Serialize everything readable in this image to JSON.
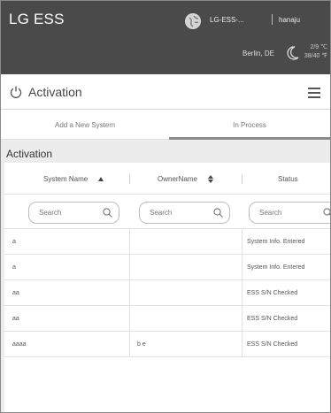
{
  "header": {
    "app_title": "LG ESS",
    "site_name": "LG-ESS-...",
    "user_name": "hanaju",
    "location": "Berlin, DE",
    "weather_temp": "2/9 ℃",
    "weather_extra": "38/40 ℉"
  },
  "page": {
    "title": "Activation"
  },
  "tabs": [
    {
      "label": "Add a New System",
      "active": false
    },
    {
      "label": "In Process",
      "active": true
    }
  ],
  "section": {
    "title": "Activation"
  },
  "table": {
    "columns": [
      {
        "label": "System Name",
        "sort": "asc"
      },
      {
        "label": "OwnerName",
        "sort": "both"
      },
      {
        "label": "Status",
        "sort": "none"
      }
    ],
    "search_placeholders": [
      "Search",
      "Search",
      "Search"
    ],
    "rows": [
      {
        "system_name": "a",
        "owner_name": "",
        "status": "System Info. Entered"
      },
      {
        "system_name": "a",
        "owner_name": "",
        "status": "System Info. Entered"
      },
      {
        "system_name": "aa",
        "owner_name": "",
        "status": "ESS S/N Checked"
      },
      {
        "system_name": "aa",
        "owner_name": "",
        "status": "ESS S/N Checked"
      },
      {
        "system_name": "aaaa",
        "owner_name": "b e",
        "status": "ESS S/N Checked"
      }
    ]
  },
  "colors": {
    "header_bg": "#4a4a4a",
    "content_bg": "#ececec",
    "active_tab_underline": "#8b8b8b"
  },
  "icons": [
    "globe-icon",
    "moon-icon",
    "power-icon",
    "menu-icon",
    "search-icon",
    "sort-asc-icon",
    "sort-icon"
  ]
}
